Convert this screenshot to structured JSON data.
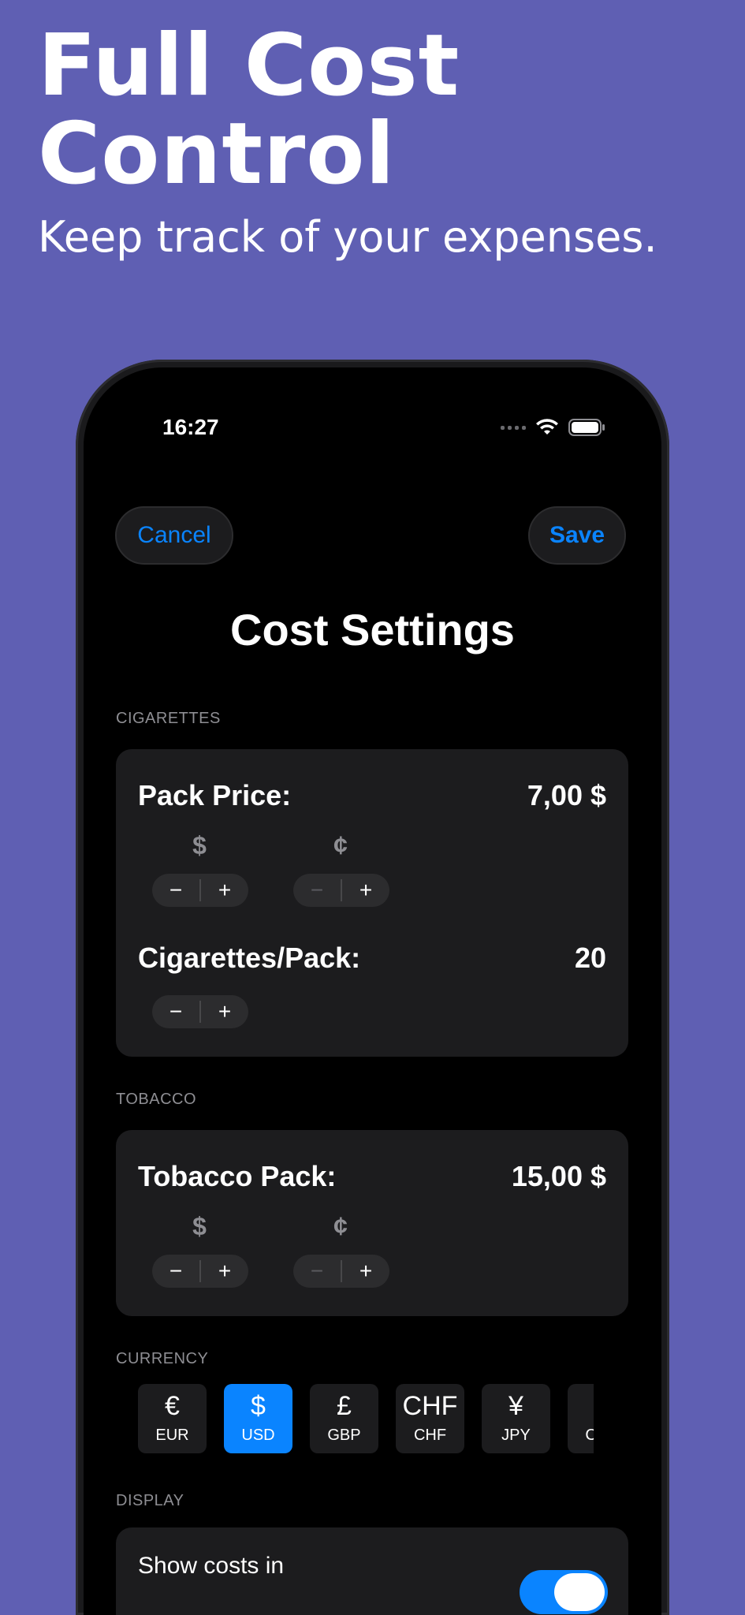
{
  "promo": {
    "headline_line1": "Full Cost",
    "headline_line2": "Control",
    "subheadline": "Keep track of your expenses."
  },
  "status_bar": {
    "time": "16:27"
  },
  "nav": {
    "cancel_label": "Cancel",
    "save_label": "Save"
  },
  "page_title": "Cost Settings",
  "cigarettes": {
    "header": "CIGARETTES",
    "pack_price_label": "Pack Price:",
    "pack_price_value": "7,00 $",
    "dollar_unit": "$",
    "cent_unit": "¢",
    "per_pack_label": "Cigarettes/Pack:",
    "per_pack_value": "20"
  },
  "tobacco": {
    "header": "TOBACCO",
    "pack_label": "Tobacco Pack:",
    "pack_value": "15,00 $",
    "dollar_unit": "$",
    "cent_unit": "¢"
  },
  "stepper": {
    "minus": "−",
    "plus": "+"
  },
  "currency": {
    "header": "CURRENCY",
    "selected": "USD",
    "options": [
      {
        "symbol": "€",
        "code": "EUR"
      },
      {
        "symbol": "$",
        "code": "USD"
      },
      {
        "symbol": "£",
        "code": "GBP"
      },
      {
        "symbol": "CHF",
        "code": "CHF"
      },
      {
        "symbol": "¥",
        "code": "JPY"
      },
      {
        "symbol": "¥",
        "code": "CNY"
      }
    ]
  },
  "display": {
    "header": "DISPLAY",
    "show_costs_label": "Show costs in",
    "show_costs_enabled": true
  },
  "colors": {
    "background": "#5f5fb3",
    "accent": "#0a84ff",
    "card": "#1c1c1e",
    "secondary_text": "#8e8e93"
  }
}
